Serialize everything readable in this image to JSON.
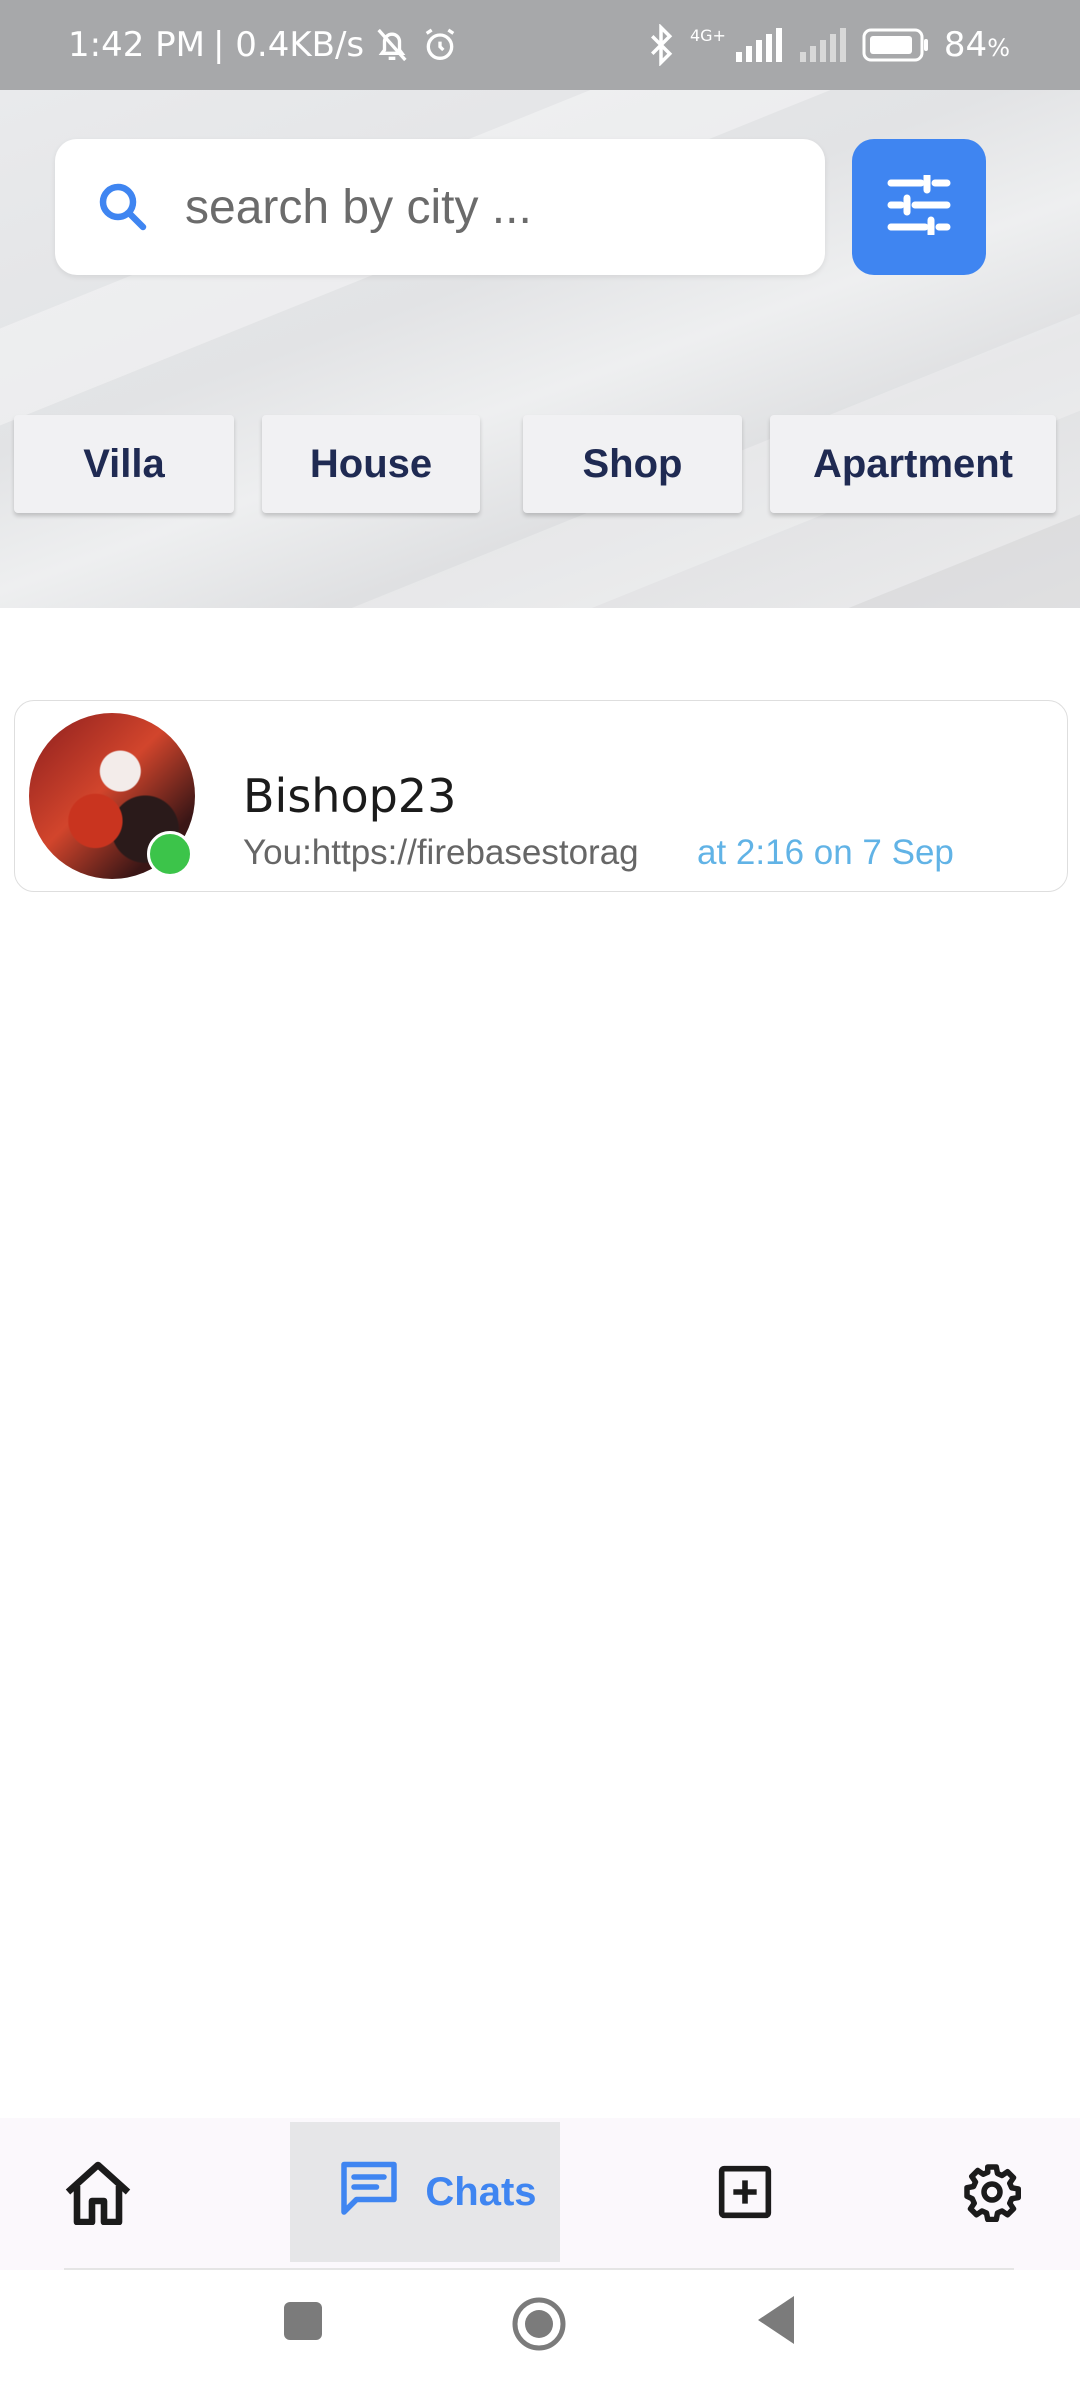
{
  "status_bar": {
    "time": "1:42 PM",
    "speed": "| 0.4KB/s",
    "network": "4G+",
    "battery": "84",
    "battery_suffix": "%"
  },
  "search": {
    "placeholder": "search by city ..."
  },
  "categories": [
    "Villa",
    "House",
    "Shop",
    "Apartment"
  ],
  "chats": [
    {
      "name": "Bishop23",
      "preview": "You:https://firebasestorag",
      "time": "at 2:16 on 7 Sep",
      "online": true
    }
  ],
  "bottom_nav": {
    "chats_label": "Chats"
  },
  "colors": {
    "accent": "#3f85f1",
    "online": "#3cc44a",
    "time_text": "#61b3e6",
    "chip_text": "#1f2a52"
  },
  "icons": {
    "search": "search-icon",
    "filter": "sliders-icon",
    "home": "home-icon",
    "chats": "chat-icon",
    "add": "add-box-icon",
    "settings": "gear-icon"
  }
}
